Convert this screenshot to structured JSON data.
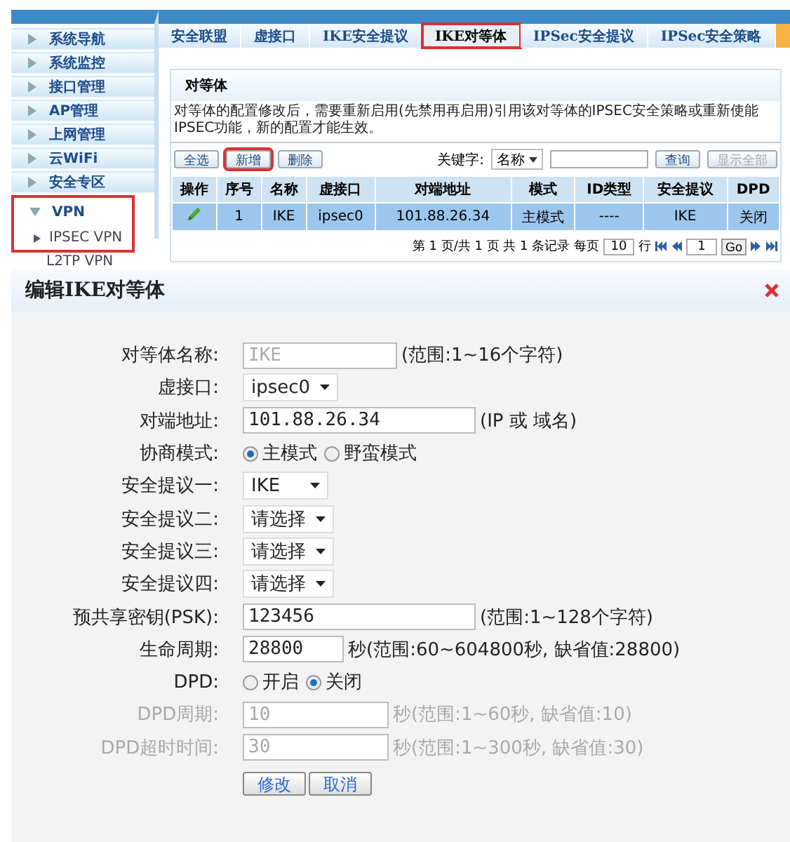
{
  "sidebar": {
    "items": [
      {
        "label": "系统导航",
        "expanded": false,
        "highlighted": false
      },
      {
        "label": "系统监控",
        "expanded": false,
        "highlighted": false
      },
      {
        "label": "接口管理",
        "expanded": false,
        "highlighted": false
      },
      {
        "label": "AP管理",
        "expanded": false,
        "highlighted": false
      },
      {
        "label": "上网管理",
        "expanded": false,
        "highlighted": false
      },
      {
        "label": "云WiFi",
        "expanded": false,
        "highlighted": false
      },
      {
        "label": "安全专区",
        "expanded": false,
        "highlighted": false
      },
      {
        "label": "VPN",
        "expanded": true,
        "highlighted": true,
        "children": [
          {
            "label": "IPSEC VPN",
            "selected": true
          },
          {
            "label": "L2TP VPN",
            "selected": false
          }
        ]
      }
    ]
  },
  "tabs": [
    {
      "label": "安全联盟",
      "selected": false,
      "highlighted": false
    },
    {
      "label": "虚接口",
      "selected": false,
      "highlighted": false
    },
    {
      "label": "IKE安全提议",
      "selected": false,
      "highlighted": false
    },
    {
      "label": "IKE对等体",
      "selected": true,
      "highlighted": true
    },
    {
      "label": "IPSec安全提议",
      "selected": false,
      "highlighted": false
    },
    {
      "label": "IPSec安全策略",
      "selected": false,
      "highlighted": false
    }
  ],
  "panel": {
    "title": "对等体",
    "notice": "对等体的配置修改后，需要重新启用(先禁用再启用)引用该对等体的IPSEC安全策略或重新使能IPSEC功能，新的配置才能生效。",
    "toolbar": [
      {
        "label": "全选",
        "highlighted": false
      },
      {
        "label": "新增",
        "highlighted": true
      },
      {
        "label": "删除",
        "highlighted": false
      }
    ],
    "search": {
      "label": "关键字:",
      "field": "名称",
      "query": "查询",
      "show_all": "显示全部",
      "show_all_disabled": true
    },
    "table": {
      "columns": [
        "操作",
        "序号",
        "名称",
        "虚接口",
        "对端地址",
        "模式",
        "ID类型",
        "安全提议",
        "DPD"
      ],
      "rows": [
        {
          "selected": true,
          "cells": [
            "",
            "1",
            "IKE",
            "ipsec0",
            "101.88.26.34",
            "主模式",
            "----",
            "IKE",
            "关闭"
          ]
        }
      ]
    },
    "pagination": {
      "summary": "第 1 页/共 1 页 共 1 条记录 每页",
      "page_size": "10",
      "rows_label": "行",
      "page": "1",
      "go": "Go"
    }
  },
  "dialog": {
    "title": "编辑IKE对等体",
    "fields": [
      {
        "kind": "text",
        "label": "对等体名称:",
        "value": "IKE",
        "hint": "(范围:1~16个字符)",
        "readonly": true,
        "disabled": false
      },
      {
        "kind": "select",
        "label": "虚接口:",
        "value": "ipsec0",
        "disabled": false
      },
      {
        "kind": "text",
        "label": "对端地址:",
        "value": "101.88.26.34",
        "hint": "(IP 或 域名)",
        "readonly": false,
        "disabled": false
      },
      {
        "kind": "radio",
        "label": "协商模式:",
        "options": [
          {
            "label": "主模式",
            "selected": true
          },
          {
            "label": "野蛮模式",
            "selected": false
          }
        ],
        "disabled": false
      },
      {
        "kind": "select",
        "label": "安全提议一:",
        "value": "IKE",
        "disabled": false
      },
      {
        "kind": "select",
        "label": "安全提议二:",
        "value": "请选择",
        "disabled": false
      },
      {
        "kind": "select",
        "label": "安全提议三:",
        "value": "请选择",
        "disabled": false
      },
      {
        "kind": "select",
        "label": "安全提议四:",
        "value": "请选择",
        "disabled": false
      },
      {
        "kind": "text",
        "label": "预共享密钥(PSK):",
        "value": "123456",
        "hint": "(范围:1~128个字符)",
        "readonly": false,
        "disabled": false
      },
      {
        "kind": "text",
        "label": "生命周期:",
        "value": "28800",
        "hint": "秒(范围:60~604800秒, 缺省值:28800)",
        "readonly": false,
        "disabled": false
      },
      {
        "kind": "radio",
        "label": "DPD:",
        "options": [
          {
            "label": "开启",
            "selected": false
          },
          {
            "label": "关闭",
            "selected": true
          }
        ],
        "disabled": false
      },
      {
        "kind": "text",
        "label": "DPD周期:",
        "value": "10",
        "hint": "秒(范围:1~60秒, 缺省值:10)",
        "readonly": false,
        "disabled": true
      },
      {
        "kind": "text",
        "label": "DPD超时时间:",
        "value": "30",
        "hint": "秒(范围:1~300秒, 缺省值:30)",
        "readonly": false,
        "disabled": true
      }
    ],
    "buttons": [
      "修改",
      "取消"
    ]
  }
}
